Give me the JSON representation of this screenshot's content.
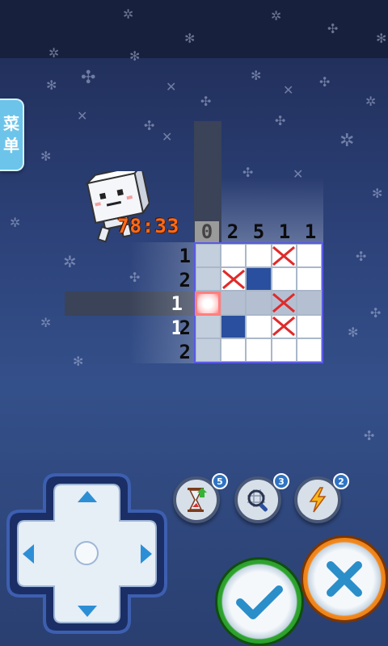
{
  "menu": {
    "label_line1": "菜",
    "label_line2": "单"
  },
  "timer": {
    "value": "78:33"
  },
  "puzzle": {
    "column_clues": [
      "0",
      "2",
      "5",
      "1",
      "1"
    ],
    "column_done": [
      true,
      false,
      false,
      false,
      false
    ],
    "row_clues": [
      "1",
      "2",
      "1 1",
      "2",
      "2"
    ],
    "active_row": 2,
    "active_col": 0,
    "cells": [
      [
        "e",
        "e",
        "e",
        "x",
        "e"
      ],
      [
        "e",
        "x",
        "f",
        "e",
        "e"
      ],
      [
        "c",
        "e",
        "e",
        "x",
        "e"
      ],
      [
        "e",
        "f",
        "e",
        "x",
        "e"
      ],
      [
        "e",
        "e",
        "e",
        "e",
        "e"
      ]
    ]
  },
  "powerups": [
    {
      "name": "hourglass-powerup",
      "count": "5"
    },
    {
      "name": "magnifier-powerup",
      "count": "3"
    },
    {
      "name": "lightning-powerup",
      "count": "2"
    }
  ],
  "colors": {
    "confirm": "#2fa52f",
    "cancel": "#f07a14",
    "filled": "#2a4f9e",
    "mark": "#e02a2a"
  }
}
